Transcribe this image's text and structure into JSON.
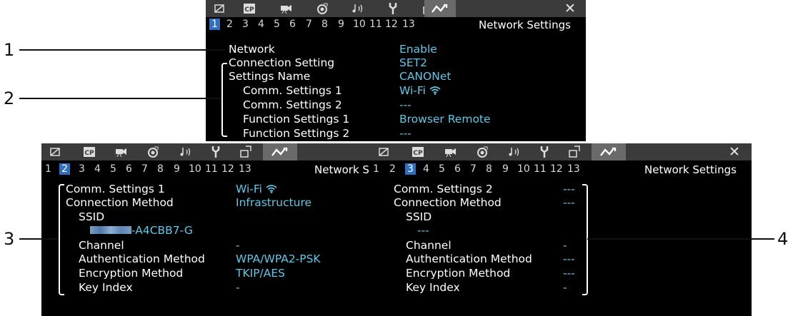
{
  "tab_icons": [
    "monitor-icon",
    "cp-icon",
    "camera-icon",
    "record-icon",
    "audio-icon",
    "wrench-icon",
    "playback-settings-icon",
    "network-icon"
  ],
  "screen1": {
    "pages": [
      "1",
      "2",
      "3",
      "4",
      "5",
      "6",
      "7",
      "8",
      "9",
      "10",
      "11",
      "12",
      "13"
    ],
    "active_page": "1",
    "title": "Network Settings",
    "close": "✕",
    "rows": [
      {
        "label": "Network",
        "value": "Enable"
      },
      {
        "label": "Connection Setting",
        "value": "SET2"
      },
      {
        "label": "Settings Name",
        "value": "CANONet"
      },
      {
        "label": "Comm. Settings 1",
        "value": "Wi-Fi"
      },
      {
        "label": "Comm. Settings 2",
        "value": "---"
      },
      {
        "label": "Function Settings 1",
        "value": "Browser Remote"
      },
      {
        "label": "Function Settings 2",
        "value": "---"
      }
    ]
  },
  "screen2": {
    "pages": [
      "1",
      "2",
      "3",
      "4",
      "5",
      "6",
      "7",
      "8",
      "9",
      "10",
      "11",
      "12",
      "13"
    ],
    "active_page": "2",
    "title": "Network S",
    "rows": [
      {
        "label": "Comm. Settings 1",
        "value": "Wi-Fi"
      },
      {
        "label": "Connection Method",
        "value": "Infrastructure"
      },
      {
        "label": "SSID",
        "value": ""
      },
      {
        "label": "",
        "value": "-A4CBB7-G"
      },
      {
        "label": "Channel",
        "value": "-"
      },
      {
        "label": "Authentication Method",
        "value": "WPA/WPA2-PSK"
      },
      {
        "label": "Encryption Method",
        "value": "TKIP/AES"
      },
      {
        "label": "Key Index",
        "value": "-"
      }
    ]
  },
  "screen3": {
    "pages": [
      "1",
      "2",
      "3",
      "4",
      "5",
      "6",
      "7",
      "8",
      "9",
      "10",
      "11",
      "12",
      "13"
    ],
    "active_page": "3",
    "title": "Network Settings",
    "close": "✕",
    "rows": [
      {
        "label": "Comm. Settings 2",
        "value": "---"
      },
      {
        "label": "Connection Method",
        "value": "---"
      },
      {
        "label": "SSID",
        "value": ""
      },
      {
        "label": "",
        "value": "---"
      },
      {
        "label": "Channel",
        "value": "-"
      },
      {
        "label": "Authentication Method",
        "value": "---"
      },
      {
        "label": "Encryption Method",
        "value": "---"
      },
      {
        "label": "Key Index",
        "value": "-"
      }
    ]
  },
  "callouts": {
    "c1": "1",
    "c2": "2",
    "c3": "3",
    "c4": "4"
  }
}
